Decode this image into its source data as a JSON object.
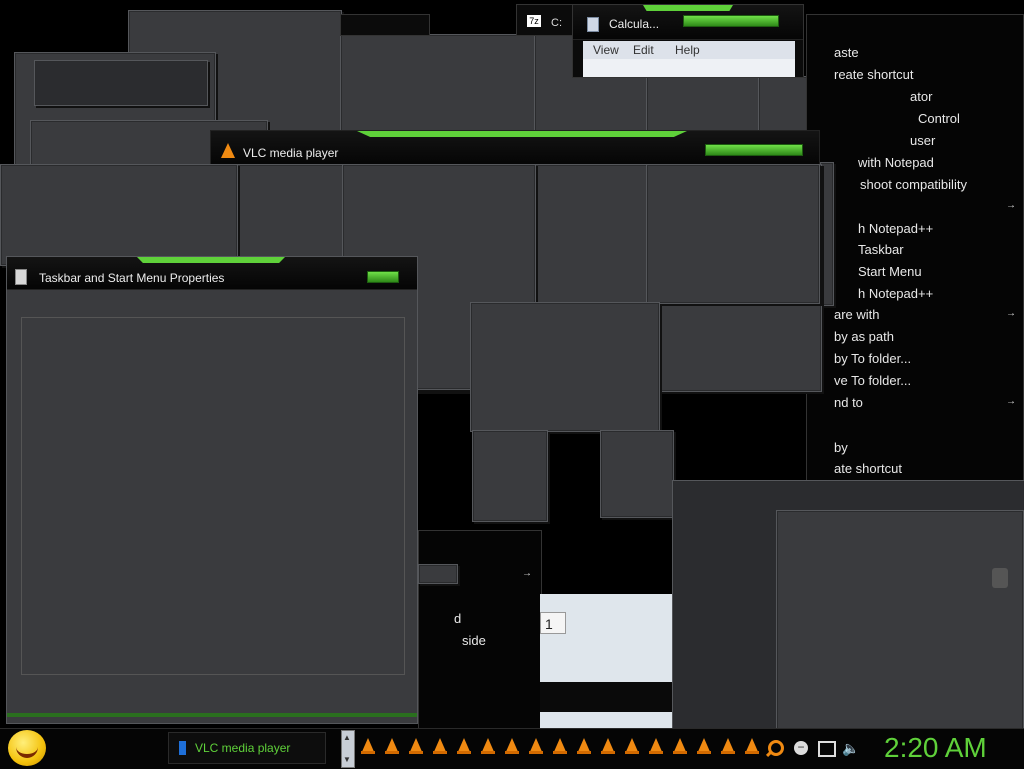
{
  "windows": {
    "vlc": {
      "title": "VLC media player"
    },
    "taskbar_props": {
      "title": "Taskbar and Start Menu Properties"
    },
    "calculator": {
      "title": "Calcula...",
      "menu": [
        "View",
        "Edit",
        "Help"
      ]
    },
    "console": {
      "title": "C:"
    }
  },
  "context_menu": {
    "items": [
      {
        "label": "aste"
      },
      {
        "label": "reate shortcut"
      },
      {
        "label": "ator"
      },
      {
        "label": "Control"
      },
      {
        "label": "user"
      },
      {
        "label": "with Notepad"
      },
      {
        "label": "shoot compatibility"
      },
      {
        "label": "h Notepad++"
      },
      {
        "label": "Taskbar"
      },
      {
        "label": "Start Menu"
      },
      {
        "label": "h Notepad++"
      },
      {
        "label": "are with"
      },
      {
        "label": "by as path"
      },
      {
        "label": "by To folder..."
      },
      {
        "label": "ve To folder..."
      },
      {
        "label": "nd to"
      },
      {
        "label": "by"
      },
      {
        "label": "ate shortcut"
      }
    ],
    "arrow": "→"
  },
  "lower_menu": {
    "items": [
      {
        "label": "d"
      },
      {
        "label": "side"
      }
    ],
    "field_value": "1",
    "arrow": "→"
  },
  "taskbar": {
    "task_label": "VLC media player",
    "clock": "2:20 AM",
    "accent": "#5fd13a",
    "cone_count": 18
  }
}
